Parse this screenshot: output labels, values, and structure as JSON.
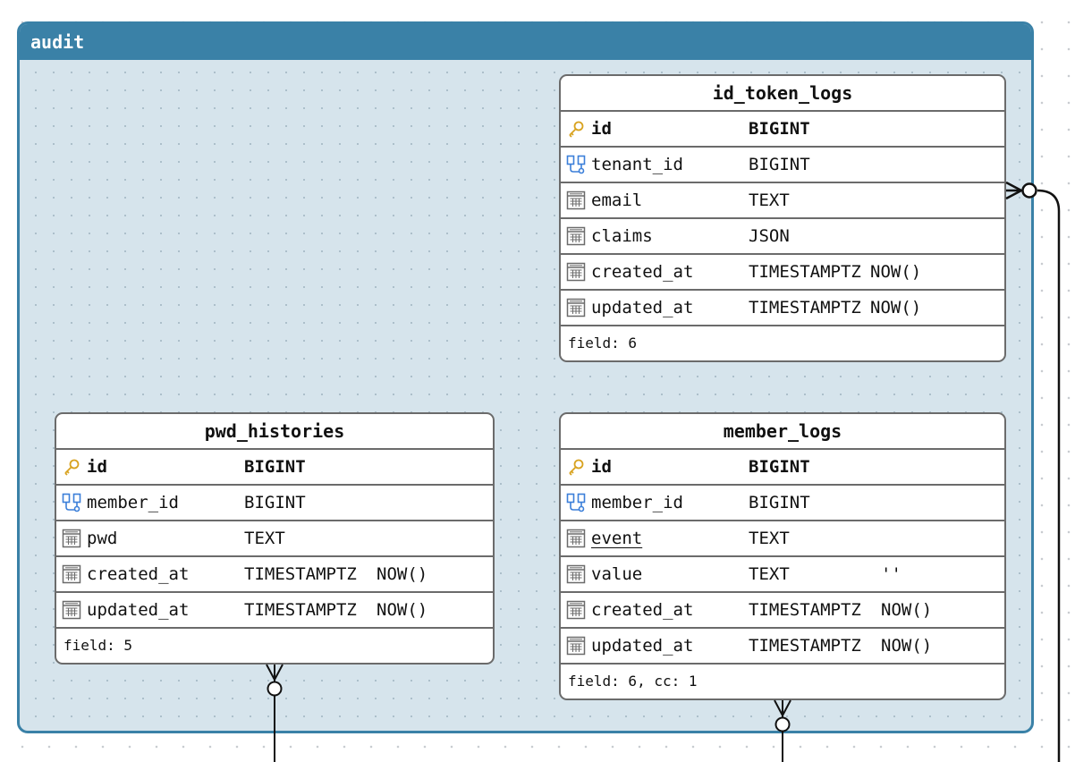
{
  "group": {
    "title": "audit"
  },
  "tables": {
    "id_token_logs": {
      "name": "id_token_logs",
      "columns": [
        {
          "name": "id",
          "type": "BIGINT",
          "default": "",
          "key": "pk"
        },
        {
          "name": "tenant_id",
          "type": "BIGINT",
          "default": "",
          "key": "fk"
        },
        {
          "name": "email",
          "type": "TEXT",
          "default": "",
          "key": "col"
        },
        {
          "name": "claims",
          "type": "JSON",
          "default": "",
          "key": "col"
        },
        {
          "name": "created_at",
          "type": "TIMESTAMPTZ",
          "default": "NOW()",
          "key": "col"
        },
        {
          "name": "updated_at",
          "type": "TIMESTAMPTZ",
          "default": "NOW()",
          "key": "col"
        }
      ],
      "footer": "field: 6"
    },
    "pwd_histories": {
      "name": "pwd_histories",
      "columns": [
        {
          "name": "id",
          "type": "BIGINT",
          "default": "",
          "key": "pk"
        },
        {
          "name": "member_id",
          "type": "BIGINT",
          "default": "",
          "key": "fk"
        },
        {
          "name": "pwd",
          "type": "TEXT",
          "default": "",
          "key": "col"
        },
        {
          "name": "created_at",
          "type": "TIMESTAMPTZ",
          "default": "NOW()",
          "key": "col"
        },
        {
          "name": "updated_at",
          "type": "TIMESTAMPTZ",
          "default": "NOW()",
          "key": "col"
        }
      ],
      "footer": "field: 5"
    },
    "member_logs": {
      "name": "member_logs",
      "columns": [
        {
          "name": "id",
          "type": "BIGINT",
          "default": "",
          "key": "pk"
        },
        {
          "name": "member_id",
          "type": "BIGINT",
          "default": "",
          "key": "fk"
        },
        {
          "name": "event",
          "type": "TEXT",
          "default": "",
          "key": "col",
          "underline": true
        },
        {
          "name": "value",
          "type": "TEXT",
          "default": "''",
          "key": "col"
        },
        {
          "name": "created_at",
          "type": "TIMESTAMPTZ",
          "default": "NOW()",
          "key": "col"
        },
        {
          "name": "updated_at",
          "type": "TIMESTAMPTZ",
          "default": "NOW()",
          "key": "col"
        }
      ],
      "footer": "field: 6, cc: 1"
    }
  },
  "colors": {
    "group_header": "#3a81a7",
    "group_fill": "#d6e4ec",
    "table_border": "#6b6b6b",
    "pk_icon": "#d8a21f",
    "fk_icon": "#3b7fd9",
    "col_icon": "#6b6b6b",
    "relation_line": "#111111"
  }
}
